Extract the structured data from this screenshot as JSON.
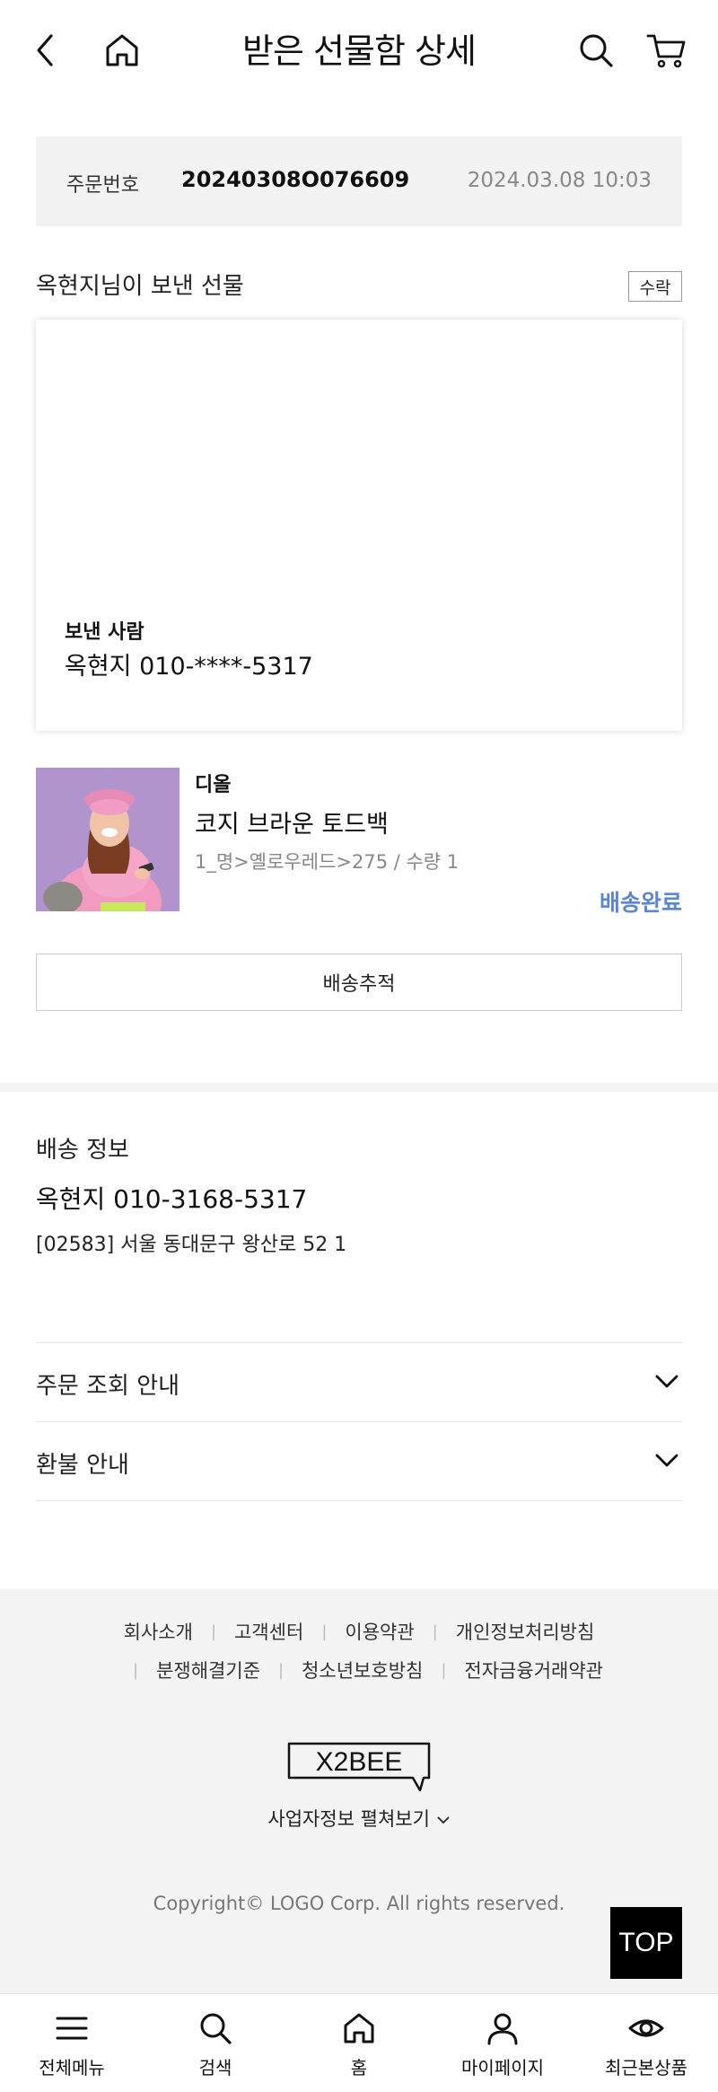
{
  "header": {
    "title": "받은 선물함 상세",
    "icons": [
      "back-icon",
      "home-icon",
      "search-icon",
      "cart-icon"
    ]
  },
  "order": {
    "label": "주문번호",
    "number": "20240308O076609",
    "datetime": "2024.03.08 10:03"
  },
  "gift": {
    "from_text": "옥현지님이 보낸 선물",
    "accept_label": "수락",
    "sender_label": "보낸 사람",
    "sender_value": "옥현지 010-****-5317"
  },
  "product": {
    "brand": "디올",
    "name": "코지 브라운 토드백",
    "option": "1_명>옐로우레드>275 / 수량 1",
    "status": "배송완료",
    "status_color": "#5b86d1",
    "track_label": "배송추적"
  },
  "delivery": {
    "title": "배송 정보",
    "name_phone": "옥현지 010-3168-5317",
    "address": "[02583] 서울 동대문구 왕산로 52 1"
  },
  "accordions": [
    {
      "label": "주문 조회 안내"
    },
    {
      "label": "환불 안내"
    }
  ],
  "footer": {
    "links_row1": [
      "회사소개",
      "고객센터",
      "이용약관",
      "개인정보처리방침"
    ],
    "links_row2": [
      "분쟁해결기준",
      "청소년보호방침",
      "전자금융거래약관"
    ],
    "logo_text": "X2BEE",
    "biz_info": "사업자정보 펼쳐보기",
    "copyright": "Copyright© LOGO Corp. All rights reserved.",
    "top_label": "TOP"
  },
  "bottom_nav": [
    {
      "label": "전체메뉴",
      "icon": "menu-icon"
    },
    {
      "label": "검색",
      "icon": "search-icon"
    },
    {
      "label": "홈",
      "icon": "home-icon"
    },
    {
      "label": "마이페이지",
      "icon": "user-icon"
    },
    {
      "label": "최근본상품",
      "icon": "eye-icon"
    }
  ]
}
